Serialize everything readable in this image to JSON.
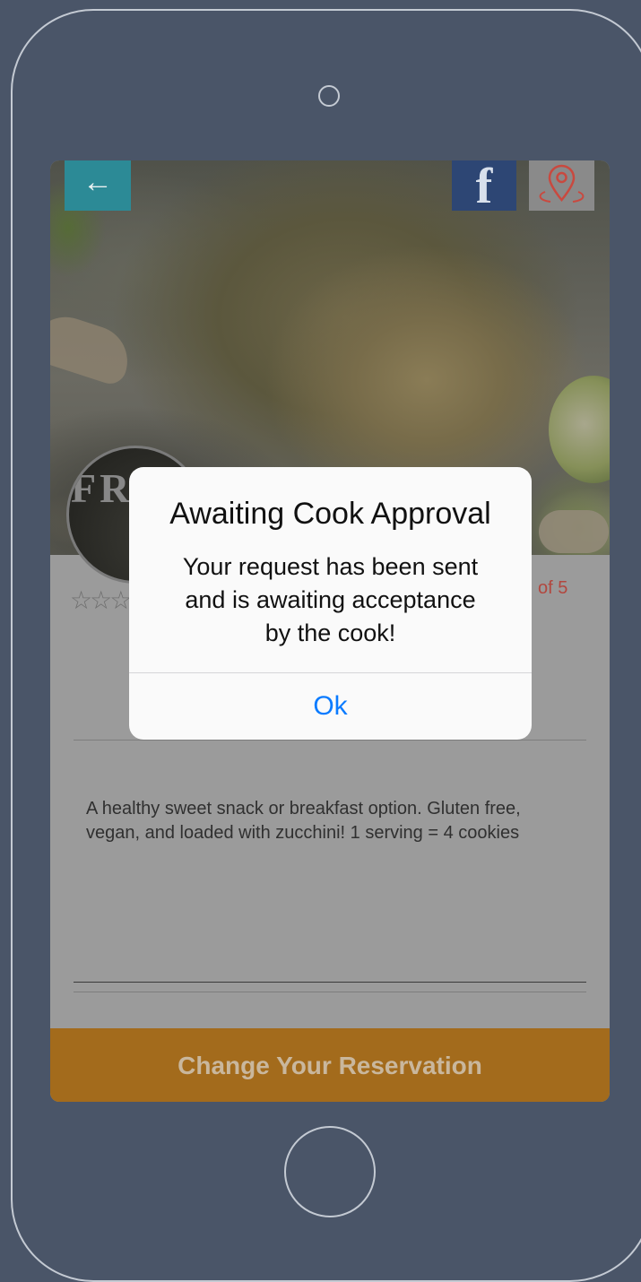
{
  "screen": {
    "back_icon": "left-arrow-icon",
    "social_icon": "facebook-icon",
    "map_icon": "location-pin-icon",
    "avatar_text": "FRE",
    "rating_suffix": "of 5",
    "description": "A healthy sweet snack or breakfast option. Gluten free, vegan, and loaded with zucchini! 1 serving = 4 cookies",
    "reserve_label": "Change Your Reservation"
  },
  "alert": {
    "title": "Awaiting Cook Approval",
    "message_lines": [
      "Your request has been sent",
      "and is awaiting acceptance",
      "by the cook!"
    ],
    "ok_label": "Ok"
  },
  "colors": {
    "background": "#4a5568",
    "back_button": "#2c8a96",
    "facebook": "#2d4674",
    "reserve_button": "#a36b1c",
    "accent_link": "#0a7bff",
    "rating_red": "#b2473f"
  }
}
